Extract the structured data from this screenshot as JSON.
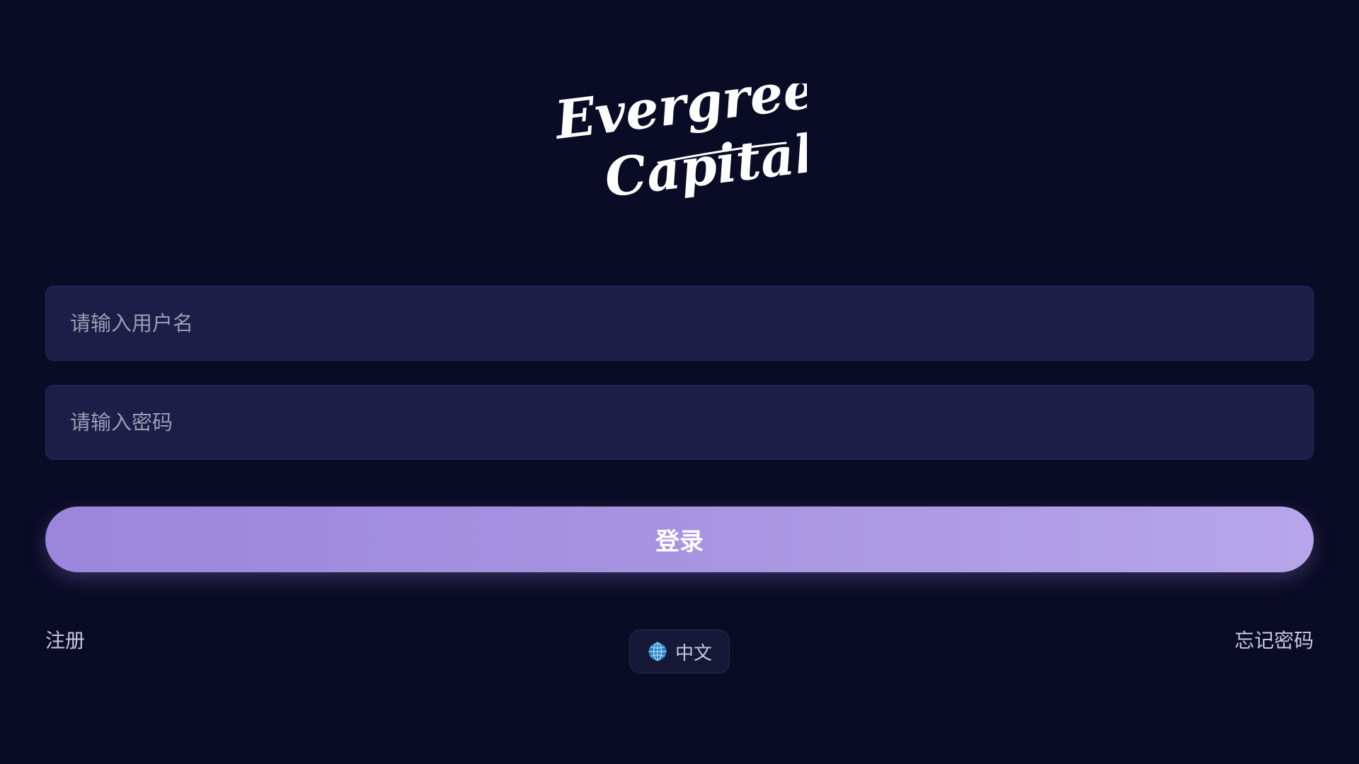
{
  "logo": {
    "line1": "Evergreen",
    "line2": "Capital"
  },
  "form": {
    "username": {
      "placeholder": "请输入用户名",
      "value": ""
    },
    "password": {
      "placeholder": "请输入密码",
      "value": ""
    },
    "login_label": "登录"
  },
  "footer": {
    "register_label": "注册",
    "forgot_label": "忘记密码",
    "language": {
      "icon": "globe-icon",
      "label": "中文"
    }
  },
  "colors": {
    "background": "#0a0b25",
    "input_background": "#1d1e47",
    "button_gradient_start": "#9a86db",
    "button_gradient_end": "#b6a6e9",
    "link_text": "#c7c8dc"
  }
}
